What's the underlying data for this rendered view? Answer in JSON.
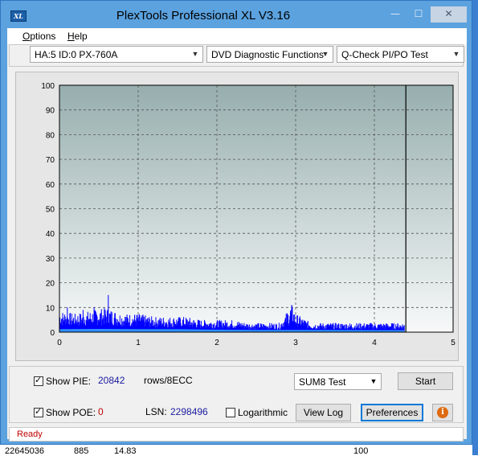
{
  "window": {
    "title": "PlexTools Professional XL V3.16",
    "icon_text": "XL",
    "minimize_glyph": "—",
    "maximize_glyph": "☐",
    "close_glyph": "✕"
  },
  "menu": {
    "options": "Options",
    "options_accel": "O",
    "options_rest": "ptions",
    "help": "Help",
    "help_accel": "H",
    "help_rest": "elp"
  },
  "toolbar": {
    "drive": "HA:5 ID:0  PX-760A",
    "function": "DVD Diagnostic Functions",
    "test": "Q-Check PI/PO Test"
  },
  "chart_data": {
    "type": "area",
    "title": "",
    "xlabel": "",
    "ylabel": "",
    "xlim": [
      0,
      5
    ],
    "ylim": [
      0,
      100
    ],
    "x_ticks": [
      "0",
      "1",
      "2",
      "3",
      "4",
      "5"
    ],
    "y_ticks": [
      "0",
      "10",
      "20",
      "30",
      "40",
      "50",
      "60",
      "70",
      "80",
      "90",
      "100"
    ],
    "grid": true,
    "end_marker_x": 4.4,
    "series": [
      {
        "color": "#0000ff",
        "x": [
          0.0,
          0.2,
          0.4,
          0.6,
          0.8,
          1.0,
          1.2,
          1.4,
          1.6,
          1.8,
          2.0,
          2.2,
          2.4,
          2.6,
          2.8,
          2.95,
          3.0,
          3.2,
          3.4,
          3.6,
          3.8,
          4.0,
          4.2,
          4.38
        ],
        "values": [
          7,
          6,
          7,
          8,
          6,
          6,
          5,
          5,
          5,
          4,
          4,
          4,
          3,
          3,
          3,
          9,
          6,
          3,
          3,
          3,
          3,
          3,
          3,
          3
        ],
        "peaks": [
          [
            0.62,
            15
          ],
          [
            0.44,
            10
          ],
          [
            0.3,
            9
          ],
          [
            2.95,
            11
          ],
          [
            0.1,
            10
          ]
        ]
      },
      {
        "color": "#2f8fff",
        "x": [
          0.0,
          0.5,
          1.0,
          1.5,
          2.0,
          2.5,
          3.0,
          3.5,
          4.0,
          4.38
        ],
        "values": [
          1.2,
          1.3,
          1.2,
          1.2,
          1.0,
          0.9,
          0.9,
          0.9,
          0.8,
          0.8
        ]
      }
    ]
  },
  "controls": {
    "show_pie_label": "Show PIE:",
    "show_pie_value": "20842",
    "show_pie_unit": "rows/8ECC",
    "show_poe_label": "Show POE:",
    "show_poe_value": "0",
    "lsn_label": "LSN:",
    "lsn_value": "2298496",
    "logarithmic_label": "Logarithmic",
    "test_select": "SUM8 Test",
    "start_button": "Start",
    "view_log_button": "View Log",
    "preferences_button": "Preferences",
    "info_glyph": "i"
  },
  "status": {
    "text": "Ready"
  },
  "background_window": {
    "col1": "22645036",
    "col2": "885",
    "col3": "14.83",
    "col4": "100"
  }
}
